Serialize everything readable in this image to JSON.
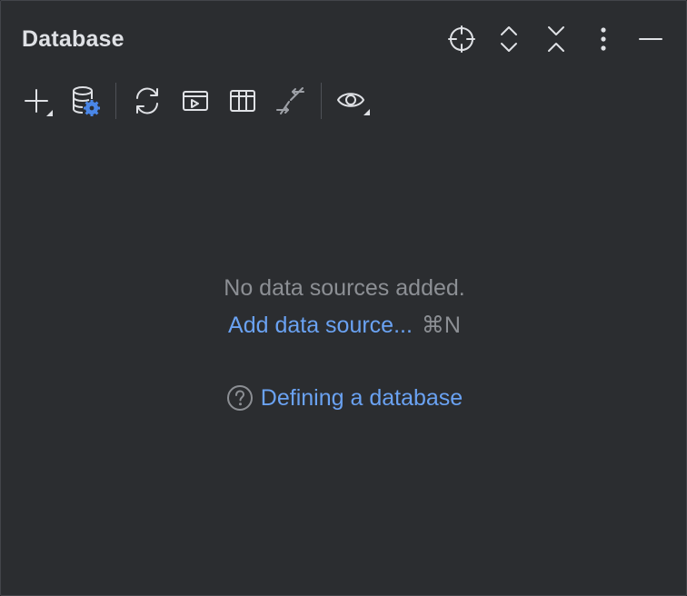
{
  "window": {
    "title": "Database"
  },
  "header_actions": [
    {
      "icon": "locate-icon"
    },
    {
      "icon": "expand-all-icon"
    },
    {
      "icon": "collapse-all-icon"
    },
    {
      "icon": "more-options-icon"
    },
    {
      "icon": "minimize-icon"
    }
  ],
  "toolbar": {
    "items": [
      {
        "icon": "add-icon"
      },
      {
        "icon": "data-source-properties-icon"
      },
      {
        "icon": "refresh-icon"
      },
      {
        "icon": "jump-to-query-console-icon"
      },
      {
        "icon": "table-view-icon"
      },
      {
        "icon": "compare-icon"
      },
      {
        "icon": "view-options-icon"
      }
    ]
  },
  "empty_state": {
    "message": "No data sources added.",
    "add_link": "Add data source...",
    "add_shortcut": "⌘N",
    "help_link": "Defining a database"
  },
  "colors": {
    "panel_bg": "#2b2d30",
    "text": "#dfe1e5",
    "muted": "#8c8f94",
    "link": "#6aa2f2",
    "accent_icon": "#4a87e8"
  }
}
